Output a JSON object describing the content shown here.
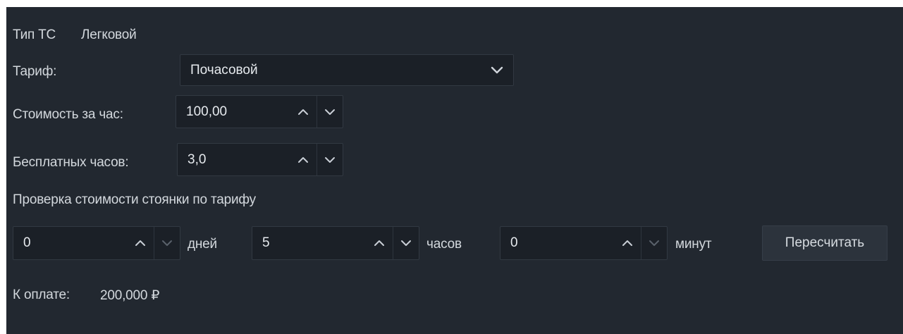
{
  "vehicle": {
    "label": "Тип ТС",
    "value": "Легковой"
  },
  "tariff": {
    "label": "Тариф:",
    "selected": "Почасовой",
    "icon": "chevron-down-icon"
  },
  "hourly_cost": {
    "label": "Стоимость за час:",
    "value": "100,00"
  },
  "free_hours": {
    "label": "Бесплатных часов:",
    "value": "3,0"
  },
  "check": {
    "heading": "Проверка стоимости стоянки по тарифу",
    "days": {
      "value": "0",
      "unit": "дней"
    },
    "hours": {
      "value": "5",
      "unit": "часов"
    },
    "minutes": {
      "value": "0",
      "unit": "минут"
    },
    "recalc_label": "Пересчитать"
  },
  "payment": {
    "label": "К оплате:",
    "amount": "200,000 ₽"
  },
  "colors": {
    "panel_bg": "#222830",
    "field_bg": "#1b2027",
    "button_bg": "#2c333c",
    "text": "#d3d8dd",
    "arrow_active": "#c9cfd6",
    "arrow_disabled": "#59616b"
  }
}
